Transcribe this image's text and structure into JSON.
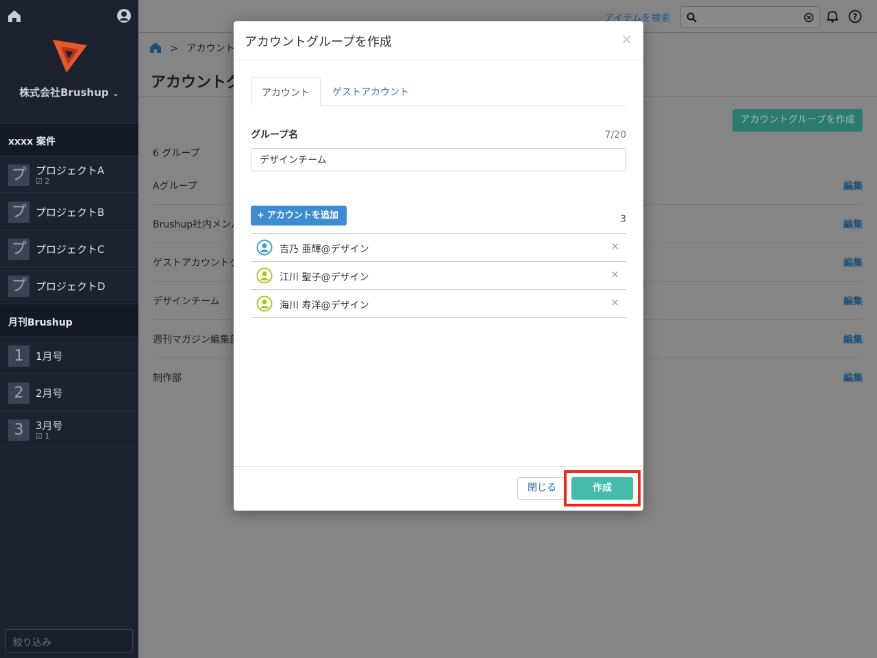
{
  "sidebar": {
    "company": "株式会社Brushup",
    "section1": "xxxx 案件",
    "projects": [
      {
        "badge": "プ",
        "label": "プロジェクトA",
        "count": "2"
      },
      {
        "badge": "プ",
        "label": "プロジェクトB"
      },
      {
        "badge": "プ",
        "label": "プロジェクトC"
      },
      {
        "badge": "プ",
        "label": "プロジェクトD"
      }
    ],
    "section2": "月刊Brushup",
    "issues": [
      {
        "badge": "1",
        "label": "1月号"
      },
      {
        "badge": "2",
        "label": "2月号"
      },
      {
        "badge": "3",
        "label": "3月号",
        "count": "1"
      }
    ],
    "filter_placeholder": "絞り込み"
  },
  "header": {
    "search_link": "アイテムを検索"
  },
  "main": {
    "breadcrumb_sep": ">",
    "breadcrumb": "アカウントグ",
    "title": "アカウントグ",
    "create_button": "アカウントグループを作成",
    "group_count": "6 グループ",
    "edit_label": "編集",
    "groups": [
      "Aグループ",
      "Brushup社内メンバ",
      "ゲストアカウントグ",
      "デザインチーム",
      "週刊マガジン編集部",
      "制作部"
    ]
  },
  "modal": {
    "title": "アカウントグループを作成",
    "close": "×",
    "tabs": [
      "アカウント",
      "ゲストアカウント"
    ],
    "field_label": "グループ名",
    "field_counter": "7/20",
    "field_value": "デザインチーム",
    "add_button": "アカウントを追加",
    "member_count": "3",
    "members": [
      {
        "name": "吉乃 亜輝@デザイン",
        "color": "#2fa3d8"
      },
      {
        "name": "江川 聖子@デザイン",
        "color": "#b6c21a"
      },
      {
        "name": "海川 寿洋@デザイン",
        "color": "#b6c21a"
      }
    ],
    "remove_glyph": "×",
    "close_button": "閉じる",
    "create_button": "作成"
  },
  "colors": {
    "sidebar_bg": "#1c2230",
    "accent_teal": "#43bcab",
    "accent_blue": "#3d8bd0",
    "highlight": "#f1281c"
  }
}
